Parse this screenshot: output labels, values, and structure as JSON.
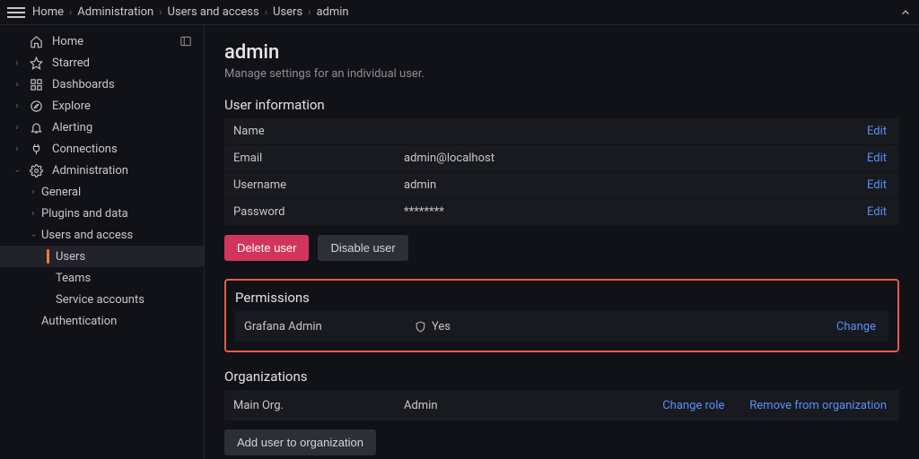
{
  "breadcrumb": [
    "Home",
    "Administration",
    "Users and access",
    "Users",
    "admin"
  ],
  "sidebar": {
    "items": [
      {
        "label": "Home",
        "icon": "home",
        "hasCaret": false
      },
      {
        "label": "Starred",
        "icon": "star",
        "hasCaret": true
      },
      {
        "label": "Dashboards",
        "icon": "grid",
        "hasCaret": true
      },
      {
        "label": "Explore",
        "icon": "compass",
        "hasCaret": true
      },
      {
        "label": "Alerting",
        "icon": "bell",
        "hasCaret": true
      },
      {
        "label": "Connections",
        "icon": "plug",
        "hasCaret": true
      },
      {
        "label": "Administration",
        "icon": "gear",
        "hasCaret": true,
        "expanded": true
      }
    ],
    "admin_children": [
      {
        "label": "General",
        "hasCaret": true
      },
      {
        "label": "Plugins and data",
        "hasCaret": true
      },
      {
        "label": "Users and access",
        "hasCaret": true,
        "expanded": true
      },
      {
        "label": "Authentication",
        "hasCaret": false
      }
    ],
    "ua_children": [
      {
        "label": "Users",
        "active": true
      },
      {
        "label": "Teams"
      },
      {
        "label": "Service accounts"
      }
    ]
  },
  "page": {
    "title": "admin",
    "subtitle": "Manage settings for an individual user."
  },
  "user_info": {
    "heading": "User information",
    "name_label": "Name",
    "name_value": "",
    "email_label": "Email",
    "email_value": "admin@localhost",
    "username_label": "Username",
    "username_value": "admin",
    "password_label": "Password",
    "password_value": "********",
    "edit": "Edit"
  },
  "buttons": {
    "delete_user": "Delete user",
    "disable_user": "Disable user",
    "add_org": "Add user to organization"
  },
  "permissions": {
    "heading": "Permissions",
    "label": "Grafana Admin",
    "value": "Yes",
    "change": "Change"
  },
  "orgs": {
    "heading": "Organizations",
    "name": "Main Org.",
    "role": "Admin",
    "change_role": "Change role",
    "remove": "Remove from organization"
  }
}
